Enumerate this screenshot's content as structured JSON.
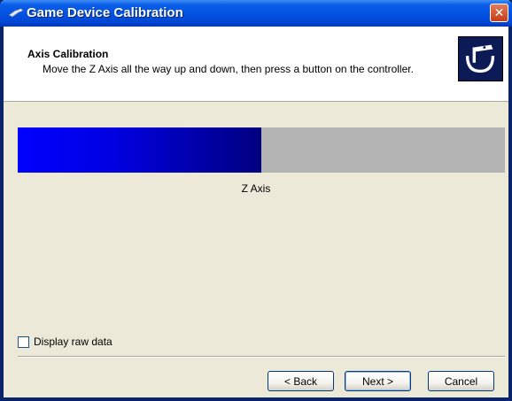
{
  "window": {
    "title": "Game Device Calibration",
    "close_glyph": "✕",
    "title_icon": "game-controller-icon"
  },
  "header": {
    "title": "Axis Calibration",
    "description": "Move the Z Axis all the way up and down, then press a button on the controller.",
    "icon": "joystick-icon"
  },
  "calibration": {
    "axis_label": "Z Axis",
    "level": 0.5,
    "fill_colors": [
      "#0000ff",
      "#000080"
    ],
    "track_color": "#b4b4b4"
  },
  "options": {
    "raw_data_label": "Display raw data",
    "raw_data_checked": false
  },
  "buttons": {
    "back": "< Back",
    "next": "Next >",
    "cancel": "Cancel"
  },
  "colors": {
    "titlebar": "#0352e2",
    "dialog_bg": "#ece9d8",
    "close_button": "#d65b37"
  }
}
